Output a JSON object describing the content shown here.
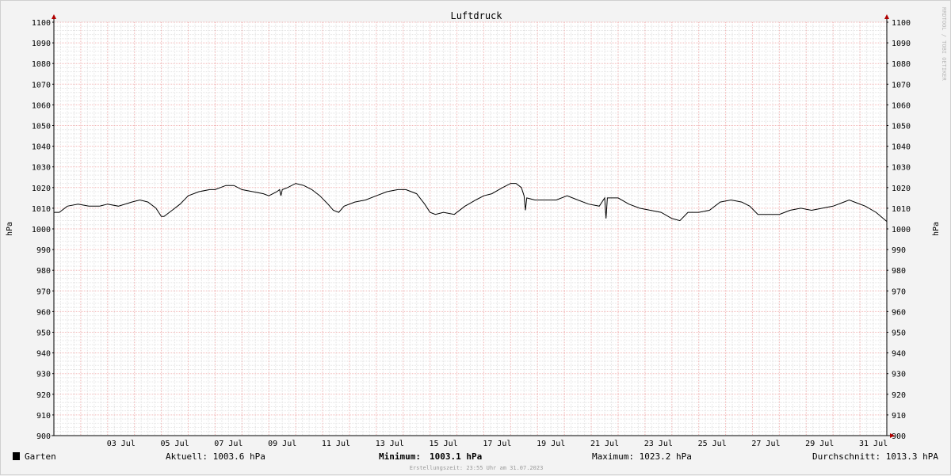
{
  "chart_data": {
    "type": "line",
    "title": "Luftdruck",
    "ylabel": "hPa",
    "ylabel_right": "hPa",
    "ylim": [
      900,
      1100
    ],
    "y_ticks": [
      900,
      910,
      920,
      930,
      940,
      950,
      960,
      970,
      980,
      990,
      1000,
      1010,
      1020,
      1030,
      1040,
      1050,
      1060,
      1070,
      1080,
      1090,
      1100
    ],
    "xlim_days": [
      1,
      32
    ],
    "x_ticks": [
      {
        "day": 3,
        "label": "03 Jul"
      },
      {
        "day": 5,
        "label": "05 Jul"
      },
      {
        "day": 7,
        "label": "07 Jul"
      },
      {
        "day": 9,
        "label": "09 Jul"
      },
      {
        "day": 11,
        "label": "11 Jul"
      },
      {
        "day": 13,
        "label": "13 Jul"
      },
      {
        "day": 15,
        "label": "15 Jul"
      },
      {
        "day": 17,
        "label": "17 Jul"
      },
      {
        "day": 19,
        "label": "19 Jul"
      },
      {
        "day": 21,
        "label": "21 Jul"
      },
      {
        "day": 23,
        "label": "23 Jul"
      },
      {
        "day": 25,
        "label": "25 Jul"
      },
      {
        "day": 27,
        "label": "27 Jul"
      },
      {
        "day": 29,
        "label": "29 Jul"
      },
      {
        "day": 31,
        "label": "31 Jul"
      }
    ],
    "grid": true,
    "series": [
      {
        "name": "Garten",
        "color": "#000000",
        "x_days": [
          1.0,
          1.2,
          1.5,
          1.9,
          2.3,
          2.7,
          3.0,
          3.4,
          3.9,
          4.2,
          4.5,
          4.8,
          5.0,
          5.1,
          5.4,
          5.7,
          6.0,
          6.4,
          6.8,
          7.0,
          7.4,
          7.7,
          8.0,
          8.4,
          8.8,
          9.0,
          9.3,
          9.4,
          9.45,
          9.5,
          9.7,
          10.0,
          10.3,
          10.6,
          10.9,
          11.2,
          11.4,
          11.6,
          11.8,
          12.2,
          12.6,
          13.0,
          13.4,
          13.8,
          14.1,
          14.5,
          14.8,
          15.0,
          15.2,
          15.5,
          15.9,
          16.3,
          16.7,
          17.0,
          17.3,
          17.7,
          18.0,
          18.2,
          18.4,
          18.5,
          18.55,
          18.6,
          18.9,
          19.3,
          19.7,
          20.1,
          20.5,
          20.9,
          21.3,
          21.5,
          21.55,
          21.6,
          22.0,
          22.4,
          22.8,
          23.2,
          23.6,
          24.0,
          24.3,
          24.6,
          25.0,
          25.4,
          25.8,
          26.2,
          26.6,
          26.9,
          27.2,
          27.6,
          28.0,
          28.4,
          28.8,
          29.2,
          29.6,
          30.0,
          30.4,
          30.6,
          30.8,
          31.2,
          31.6,
          32.0
        ],
        "values": [
          1008,
          1008,
          1011,
          1012,
          1011,
          1011,
          1012,
          1011,
          1013,
          1014,
          1013,
          1010,
          1006,
          1006,
          1009,
          1012,
          1016,
          1018,
          1019,
          1019,
          1021,
          1021,
          1019,
          1018,
          1017,
          1016,
          1018,
          1019,
          1016,
          1019,
          1020,
          1022,
          1021,
          1019,
          1016,
          1012,
          1009,
          1008,
          1011,
          1013,
          1014,
          1016,
          1018,
          1019,
          1019,
          1017,
          1012,
          1008,
          1007,
          1008,
          1007,
          1011,
          1014,
          1016,
          1017,
          1020,
          1022,
          1022,
          1020,
          1016,
          1009,
          1015,
          1014,
          1014,
          1014,
          1016,
          1014,
          1012,
          1011,
          1015,
          1005,
          1015,
          1015,
          1012,
          1010,
          1009,
          1008,
          1005,
          1004,
          1008,
          1008,
          1009,
          1013,
          1014,
          1013,
          1011,
          1007,
          1007,
          1007,
          1009,
          1010,
          1009,
          1010,
          1011,
          1013,
          1014,
          1013,
          1011,
          1008,
          1003.6
        ]
      }
    ],
    "legend_position": "bottom-left"
  },
  "watermark": "RRDTOOL / TOBI OETIKER",
  "footer": {
    "legend_label": "Garten",
    "legend_color": "#000000",
    "current": "Aktuell: 1003.6 hPa",
    "minimum_label": "Minimum:",
    "minimum_value": "1003.1 hPa",
    "maximum": "Maximum: 1023.2 hPa",
    "average": "Durchschnitt: 1013.3 hPA",
    "created": "Erstellungszeit: 23:55 Uhr am 31.07.2023"
  },
  "colors": {
    "plot_background": "#ffffff",
    "grid_minor": "#e4e4e4",
    "grid_major": "#f2b8b8",
    "axis": "#000000",
    "arrow": "#b00000"
  }
}
